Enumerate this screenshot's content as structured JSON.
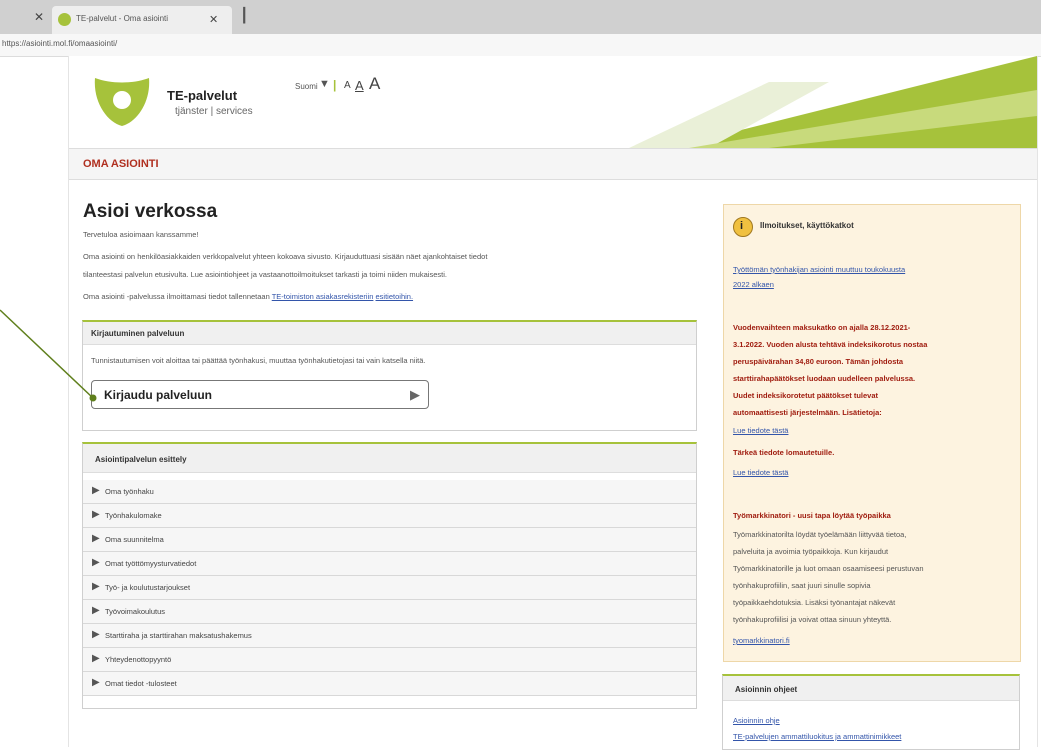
{
  "browser": {
    "tab_title": "TE-palvelut - Oma asiointi",
    "url": "https://asiointi.mol.fi/omaasiointi/"
  },
  "header": {
    "brand_name": "TE-palvelut",
    "brand_sub": "tjänster | services",
    "language": "Suomi",
    "font_sizes": [
      "A",
      "A",
      "A"
    ],
    "section_title": "OMA ASIOINTI"
  },
  "main": {
    "title": "Asioi verkossa",
    "welcome": "Tervetuloa asioimaan kanssamme!",
    "intro_lines": [
      "Oma asiointi on henkilöasiakkaiden verkkopalvelut yhteen kokoava sivusto. Kirjauduttuasi sisään näet ajankohtaiset tiedot",
      "tilanteestasi palvelun etusivulta. Lue asiointiohjeet ja vastaanottoilmoitukset tarkasti ja toimi niiden mukaisesti."
    ],
    "register_text": "Oma asiointi -palvelussa ilmoittamasi tiedot tallennetaan",
    "register_link": "TE-toimiston asiakasrekisteriin",
    "register_link2": "esitietoihin.",
    "login_box": {
      "title": "Kirjautuminen palveluun",
      "text": "Tunnistautumisen voit aloittaa tai päättää työnhakusi, muuttaa työnhakutietojasi tai vain katsella niitä.",
      "button_label": "Kirjaudu palveluun"
    },
    "presentation_box": {
      "title": "Asiointipalvelun esittely",
      "items": [
        "Oma työnhaku",
        "Työnhakulomake",
        "Oma suunnitelma",
        "Omat työttömyysturvatiedot",
        "Työ- ja koulutustarjoukset",
        "Työvoimakoulutus",
        "Starttiraha ja starttirahan maksatushakemus",
        "Yhteydenottopyyntö",
        "Omat tiedot -tulosteet"
      ]
    }
  },
  "sidebar": {
    "notice_title": "Ilmoitukset, käyttökatkot",
    "link1_lines": [
      "Työttömän työnhakijan asiointi muuttuu toukokuusta",
      "2022 alkaen"
    ],
    "red_lines": [
      "Vuodenvaihteen maksukatko on ajalla 28.12.2021-",
      "3.1.2022. Vuoden alusta tehtävä indeksikorotus nostaa",
      "peruspäivärahan 34,80 euroon. Tämän johdosta",
      "starttirahapäätökset luodaan uudelleen palvelussa.",
      "Uudet indeksikorotetut päätökset tulevat",
      "automaattisesti järjestelmään. Lisätietoja:"
    ],
    "read_more_1": "Lue tiedote tästä",
    "important_title": "Tärkeä tiedote lomautetuille.",
    "read_more_2": "Lue tiedote tästä",
    "tm_title": "Työmarkkinatori - uusi tapa löytää työpaikka",
    "tm_lines": [
      "Työmarkkinatorilta löydät työelämään liittyvää tietoa,",
      "palveluita ja avoimia työpaikkoja. Kun kirjaudut",
      "Työmarkkinatorille ja luot omaan osaamiseesi perustuvan",
      "työnhakuprofiilin, saat juuri sinulle sopivia",
      "työpaikkaehdotuksia. Lisäksi työnantajat näkevät",
      "työnhakuprofiilisi ja voivat ottaa sinuun yhteyttä."
    ],
    "tm_link": "tyomarkkinatori.fi",
    "guide_title": "Asioinnin ohjeet",
    "guide_links": [
      "Asioinnin ohje",
      "TE-palvelujen ammattiluokitus ja ammattinimikkeet"
    ]
  },
  "colors": {
    "brand_green": "#a6c23b",
    "section_red": "#b03020",
    "notice_bg": "#fdf3e0",
    "link_blue": "#3355aa"
  }
}
